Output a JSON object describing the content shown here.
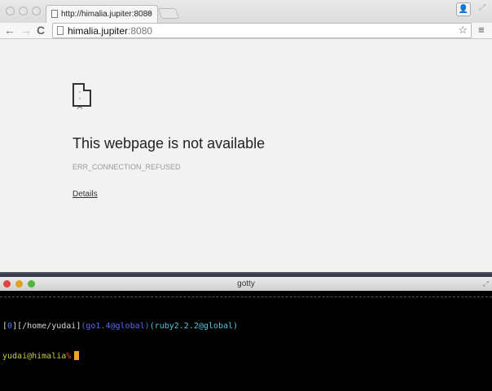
{
  "browser": {
    "tab_title": "http://himalia.jupiter:8080",
    "tab_close": "×",
    "address_host": "himalia.jupiter",
    "address_port": ":8080",
    "back": "←",
    "forward": "→",
    "reload": "C",
    "star": "☆",
    "menu": "≡",
    "profile": "👤",
    "fullscreen": "⤢"
  },
  "error_page": {
    "title": "This webpage is not available",
    "code": "ERR_CONNECTION_REFUSED",
    "details_link": "Details",
    "icon": "sad-page-icon"
  },
  "terminal": {
    "title": "gotty",
    "prompt_line1": [
      {
        "text": "[",
        "color": "#d8d8d8"
      },
      {
        "text": "0",
        "color": "#4a7cff"
      },
      {
        "text": "][/home/yudai]",
        "color": "#d8d8d8"
      },
      {
        "text": "(go1.4@global)",
        "color": "#5a6cf0"
      },
      {
        "text": "(ruby2.2.2@global)",
        "color": "#4ec8e0"
      }
    ],
    "user_host": "yudai@himalia",
    "prompt_char": "%",
    "colors": {
      "user_host": "#c8d040",
      "prompt_char": "#e04040",
      "cursor": "#f0a030"
    }
  }
}
